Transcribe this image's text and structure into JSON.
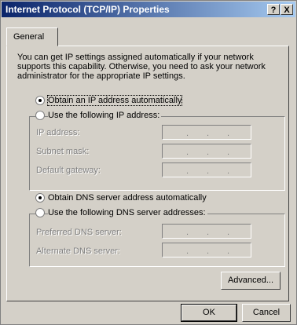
{
  "window": {
    "title": "Internet Protocol (TCP/IP) Properties",
    "help_button": "?",
    "close_button": "X"
  },
  "tabs": [
    {
      "label": "General"
    }
  ],
  "description": "You can get IP settings assigned automatically if your network supports this capability. Otherwise, you need to ask your network administrator for the appropriate IP settings.",
  "ip": {
    "auto_label": "Obtain an IP address automatically",
    "auto_selected": true,
    "manual_label": "Use the following IP address:",
    "manual_selected": false,
    "fields": [
      {
        "label": "IP address:",
        "value": ". . ."
      },
      {
        "label": "Subnet mask:",
        "value": ". . ."
      },
      {
        "label": "Default gateway:",
        "value": ". . ."
      }
    ]
  },
  "dns": {
    "auto_label": "Obtain DNS server address automatically",
    "auto_selected": true,
    "manual_label": "Use the following DNS server addresses:",
    "manual_selected": false,
    "fields": [
      {
        "label": "Preferred DNS server:",
        "value": ". . ."
      },
      {
        "label": "Alternate DNS server:",
        "value": ". . ."
      }
    ]
  },
  "buttons": {
    "advanced": "Advanced...",
    "ok": "OK",
    "cancel": "Cancel"
  },
  "colors": {
    "titlebar_start": "#0a246a",
    "titlebar_end": "#a6caf0",
    "face": "#d4d0c8"
  }
}
